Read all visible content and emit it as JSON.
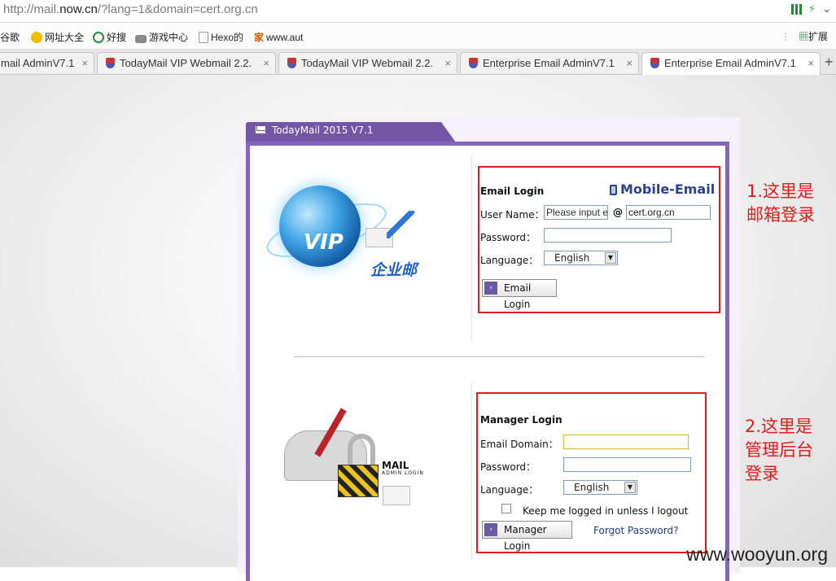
{
  "browser": {
    "url_prefix": "http://mail.",
    "url_domain": "now.cn",
    "url_suffix": "/?lang=1&domain=cert.org.cn",
    "bookmarks": [
      {
        "label": "谷歌",
        "icon": "google-icon"
      },
      {
        "label": "网址大全",
        "icon": "nav-icon"
      },
      {
        "label": "好搜",
        "icon": "search-icon"
      },
      {
        "label": "游戏中心",
        "icon": "gamepad-icon"
      },
      {
        "label": "Hexo的",
        "icon": "page-icon"
      },
      {
        "label": "www.aut",
        "icon": "home-icon"
      }
    ],
    "extensions_label": "扩展",
    "tabs": [
      {
        "label": "mail AdminV7.1"
      },
      {
        "label": "TodayMail VIP Webmail 2.2."
      },
      {
        "label": "TodayMail VIP Webmail 2.2."
      },
      {
        "label": "Enterprise Email AdminV7.1"
      },
      {
        "label": "Enterprise Email AdminV7.1"
      }
    ]
  },
  "mail": {
    "header_title": "TodayMail 2015 V7.1",
    "cn_logo_text": "企业邮",
    "email_login": {
      "title": "Email Login",
      "mobile_label": "Mobile-Email",
      "username_label": "User Name：",
      "username_placeholder": "Please input e",
      "at": "@",
      "domain_value": "cert.org.cn",
      "password_label": "Password：",
      "language_label": "Language：",
      "language_value": "English",
      "button_label": "Email Login"
    },
    "manager_login": {
      "title": "Manager Login",
      "domain_label": "Email Domain：",
      "password_label": "Password：",
      "language_label": "Language：",
      "language_value": "English",
      "keep_logged_label": "Keep me logged in unless I logout",
      "button_label": "Manager Login",
      "forgot_label": "Forgot Password?",
      "logo_mail": "MAIL",
      "logo_sub": "ADMIN LOGIN"
    }
  },
  "annotations": {
    "note1_line1": "1.这里是",
    "note1_line2": "邮箱登录",
    "note2_line1": "2.这里是",
    "note2_line2": "管理后台",
    "note2_line3": "登录",
    "watermark": "www.wooyun.org",
    "color": "#e31b1b"
  }
}
